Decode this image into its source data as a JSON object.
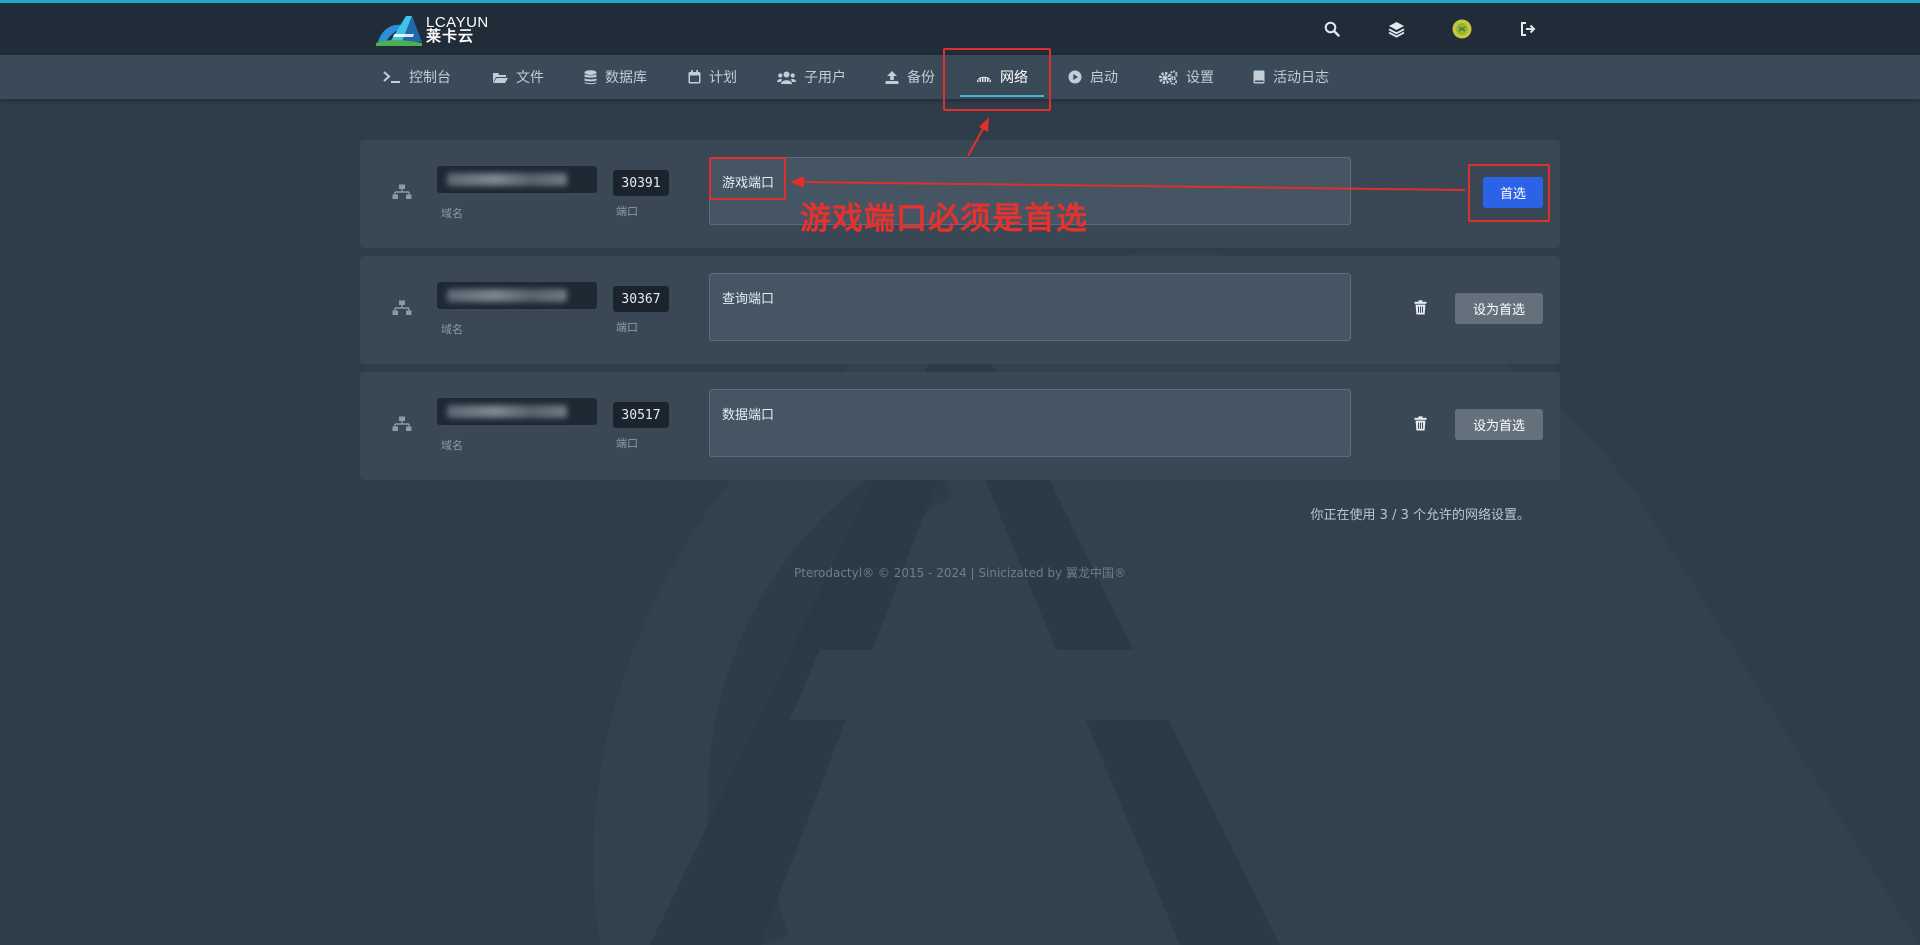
{
  "brand": {
    "name_en": "LCAYUN",
    "name_cn": "莱卡云"
  },
  "topbar": {
    "icons": [
      "search-icon",
      "layers-icon",
      "avatar-icon",
      "logout-icon"
    ]
  },
  "nav": {
    "items": [
      {
        "label": "控制台",
        "icon": "terminal-icon"
      },
      {
        "label": "文件",
        "icon": "folder-icon"
      },
      {
        "label": "数据库",
        "icon": "database-icon"
      },
      {
        "label": "计划",
        "icon": "calendar-icon"
      },
      {
        "label": "子用户",
        "icon": "users-icon"
      },
      {
        "label": "备份",
        "icon": "upload-icon"
      },
      {
        "label": "网络",
        "icon": "network-icon",
        "active": true
      },
      {
        "label": "启动",
        "icon": "play-icon"
      },
      {
        "label": "设置",
        "icon": "cogs-icon"
      },
      {
        "label": "活动日志",
        "icon": "book-icon"
      }
    ]
  },
  "allocations": [
    {
      "hostname_label": "域名",
      "port": "30391",
      "port_label": "端口",
      "notes": "游戏端口",
      "primary": true,
      "button": "首选"
    },
    {
      "hostname_label": "域名",
      "port": "30367",
      "port_label": "端口",
      "notes": "查询端口",
      "primary": false,
      "button": "设为首选"
    },
    {
      "hostname_label": "域名",
      "port": "30517",
      "port_label": "端口",
      "notes": "数据端口",
      "primary": false,
      "button": "设为首选"
    }
  ],
  "annotation": {
    "text": "游戏端口必须是首选",
    "color": "#e0302d"
  },
  "usage": "你正在使用 3 / 3 个允许的网络设置。",
  "footer": "Pterodactyl® © 2015 - 2024 | Sinicizated by 翼龙中国®",
  "colors": {
    "background": "#2f3c4a",
    "topbar": "#202c38",
    "navbar": "#3b4a59",
    "accent": "#25a6c8",
    "primary_button": "#2c63e6",
    "secondary_button": "#64717d"
  }
}
